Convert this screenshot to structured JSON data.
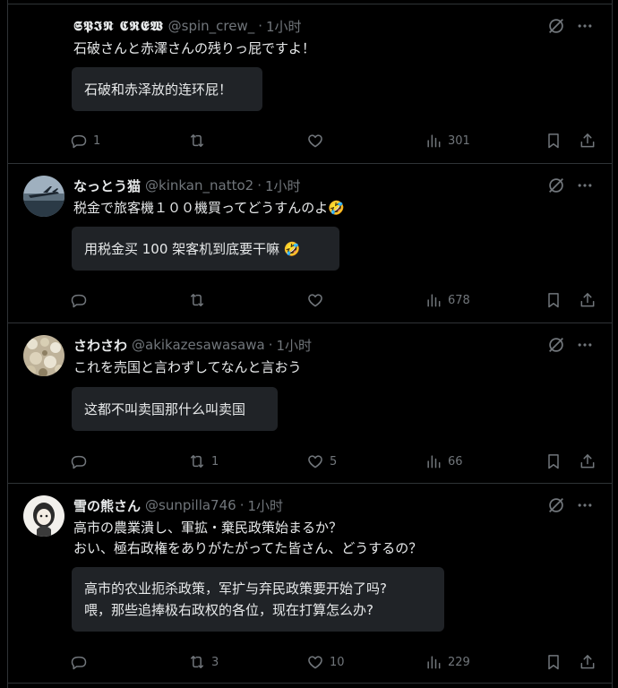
{
  "tweets": [
    {
      "display_name": "𝕾𝕻𝕴𝕹 𝕮𝕽𝕰𝖂",
      "handle": "@spin_crew_",
      "time": "1小时",
      "text": [
        "石破さんと赤澤さんの残りっ屁ですよ！"
      ],
      "translation": [
        "石破和赤泽放的连环屁！"
      ],
      "replies": "1",
      "retweets": "",
      "likes": "",
      "views": "301",
      "avatar": "none"
    },
    {
      "display_name": "なっとう猫",
      "handle": "@kinkan_natto2",
      "time": "1小时",
      "text": [
        "税金で旅客機１００機買ってどうすんのよ🤣"
      ],
      "translation": [
        "用税金买 100 架客机到底要干嘛 🤣"
      ],
      "replies": "",
      "retweets": "",
      "likes": "",
      "views": "678",
      "avatar": "airplane-photo"
    },
    {
      "display_name": "さわさわ",
      "handle": "@akikazesawasawa",
      "time": "1小时",
      "text": [
        "これを売国と言わずしてなんと言おう"
      ],
      "translation": [
        "这都不叫卖国那什么叫卖国"
      ],
      "replies": "",
      "retweets": "1",
      "likes": "5",
      "views": "66",
      "avatar": "flowers-photo"
    },
    {
      "display_name": "雪の熊さん",
      "handle": "@sunpilla746",
      "time": "1小时",
      "text": [
        "高市の農業潰し、軍拡・棄民政策始まるか？",
        "おい、極右政権をありがたがってた皆さん、どうするの？"
      ],
      "translation": [
        "高市的农业扼杀政策，军扩与弃民政策要开始了吗?",
        "喂，那些追捧极右政权的各位，现在打算怎么办?"
      ],
      "replies": "",
      "retweets": "3",
      "likes": "10",
      "views": "229",
      "avatar": "character-illustration"
    }
  ],
  "ui": {
    "separator": "·",
    "icons": [
      "grok-icon",
      "more-icon",
      "reply-icon",
      "retweet-icon",
      "like-icon",
      "views-icon",
      "bookmark-icon",
      "share-icon"
    ],
    "colors": {
      "background": "#000000",
      "text": "#e7e9ea",
      "muted": "#71767b",
      "border": "#2f3336",
      "translation_bg": "#202327"
    }
  }
}
